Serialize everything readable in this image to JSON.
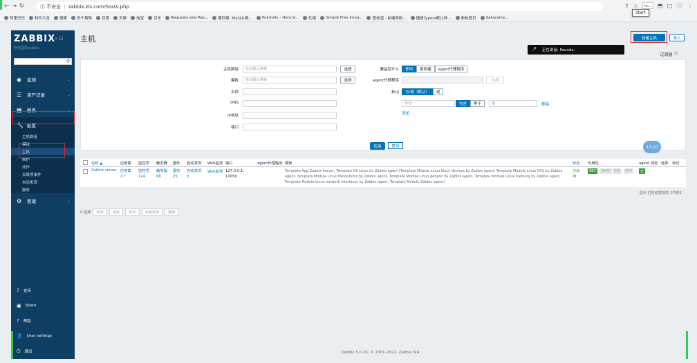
{
  "browser": {
    "insecure_label": "不安全",
    "url": "zabbix.zls.com/hosts.php",
    "profile": "Pou...",
    "tooltip": "Start",
    "bookmarks": [
      "阿里巴巴",
      "软件大全",
      "搜索",
      "苏宁易购",
      "百度",
      "天猫",
      "淘宝",
      "京东",
      "Requests and Res...",
      "第四章: MySQL数...",
      "Pointofix - Herunt...",
      "约束",
      "Simple Free Imag...",
      "管老湿 - 前端导航...",
      "播放Typora默认样...",
      "新标签页",
      "Sakuraine..."
    ]
  },
  "sidebar": {
    "logo": "ZABBIX",
    "collapse": "«",
    "subtitle": "管老湿的zabbix",
    "search_icon": "search-icon",
    "menu": [
      {
        "label": "监测",
        "icon": "eye-icon"
      },
      {
        "label": "资产记录",
        "icon": "list-icon"
      },
      {
        "label": "报表",
        "icon": "chart-icon"
      },
      {
        "label": "配置",
        "icon": "wrench-icon"
      }
    ],
    "config_sub": [
      "主机群组",
      "模板",
      "主机",
      "维护",
      "动作",
      "关联项事件",
      "自动发现",
      "服务"
    ],
    "admin": {
      "label": "管理",
      "icon": "gear-icon"
    },
    "bottom": [
      {
        "label": "支持",
        "icon": "support-icon"
      },
      {
        "label": "Share",
        "icon": "share-icon"
      },
      {
        "label": "帮助",
        "icon": "help-icon"
      },
      {
        "label": "User settings",
        "icon": "user-icon"
      },
      {
        "label": "退出",
        "icon": "power-icon"
      }
    ]
  },
  "main": {
    "title": "主机",
    "create_host": "创建主机",
    "import": "导入",
    "toast": "正在讲话: Pounds;",
    "filter_tab": "过滤器",
    "timer": "13:10"
  },
  "filter": {
    "host_group_label": "主机群组",
    "host_group_placeholder": "在此输入搜索",
    "template_label": "模板",
    "template_placeholder": "在此输入搜索",
    "name_label": "名称",
    "dns_label": "DNS",
    "ip_label": "IP地址",
    "port_label": "端口",
    "select": "选择",
    "monitored_by_label": "要监控什么",
    "monitored_by": [
      "任何",
      "服务器",
      "agent代理程序"
    ],
    "proxy_label": "agent代理程序",
    "proxy_select": "选择",
    "tags_label": "标记",
    "tag_ops": [
      "与/或（默认）",
      "或"
    ],
    "tag_placeholder": "标记",
    "tag_contains": "包含",
    "tag_equals": "等于",
    "tag_value_placeholder": "值",
    "tag_remove": "移除",
    "tag_add": "添加",
    "apply": "应用",
    "reset": "重设"
  },
  "table": {
    "headers": [
      "名称 ▲",
      "应用集",
      "监控项",
      "触发器",
      "图形",
      "自动发现",
      "Web监测",
      "接口",
      "agent代理程序",
      "模板",
      "状态",
      "可用性",
      "agent 加密",
      "信息",
      "标记"
    ],
    "row": {
      "name": "Zabbix server",
      "apps": "应用集 17",
      "items": "监控项 124",
      "triggers": "触发器 68",
      "graphs": "图形 25",
      "discovery": "自动发现 3",
      "web": "Web监测",
      "interface": "127.0.0.1: 10050",
      "templates": "Template App Zabbix Server, Template OS Linux by Zabbix agent (Template Module Linux block devices by Zabbix agent, Template Module Linux CPU by Zabbix agent, Template Module Linux filesystems by Zabbix agent, Template Module Linux generic by Zabbix agent, Template Module Linux memory by Zabbix agent, Template Module Linux network interfaces by Zabbix agent, Template Module Zabbix agent)",
      "status": "已启用",
      "zbx": "ZBX",
      "snmp": "SNMP",
      "jmx": "JMX",
      "ipmi": "IPMI",
      "encryption": "无"
    },
    "summary": "显示 已自动发现的 1中的1",
    "selected": "0 选择",
    "actions": [
      "启用",
      "禁用",
      "导出",
      "批量更新",
      "删除"
    ]
  },
  "footer": "Zabbix 5.0.26. © 2001–2022, Zabbix SIA"
}
